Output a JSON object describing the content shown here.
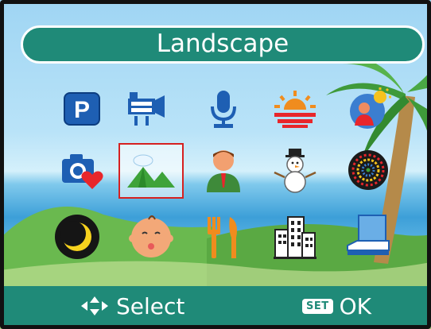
{
  "title": "Landscape",
  "colors": {
    "bar": "#1f8a78",
    "selection": "#d62020"
  },
  "icons": [
    {
      "name": "program-p-icon",
      "letter": "P"
    },
    {
      "name": "movie-camera-icon"
    },
    {
      "name": "microphone-icon"
    },
    {
      "name": "sunset-icon"
    },
    {
      "name": "backlight-portrait-icon"
    },
    {
      "name": "camera-heart-icon"
    },
    {
      "name": "landscape-mountains-icon"
    },
    {
      "name": "portrait-person-icon"
    },
    {
      "name": "snowman-icon"
    },
    {
      "name": "fireworks-icon"
    },
    {
      "name": "night-moon-icon"
    },
    {
      "name": "baby-face-icon"
    },
    {
      "name": "food-fork-knife-icon"
    },
    {
      "name": "building-icon"
    },
    {
      "name": "document-text-icon"
    }
  ],
  "selected_index": 6,
  "bottom_bar": {
    "select_label": "Select",
    "set_label": "SET",
    "ok_label": "OK"
  }
}
